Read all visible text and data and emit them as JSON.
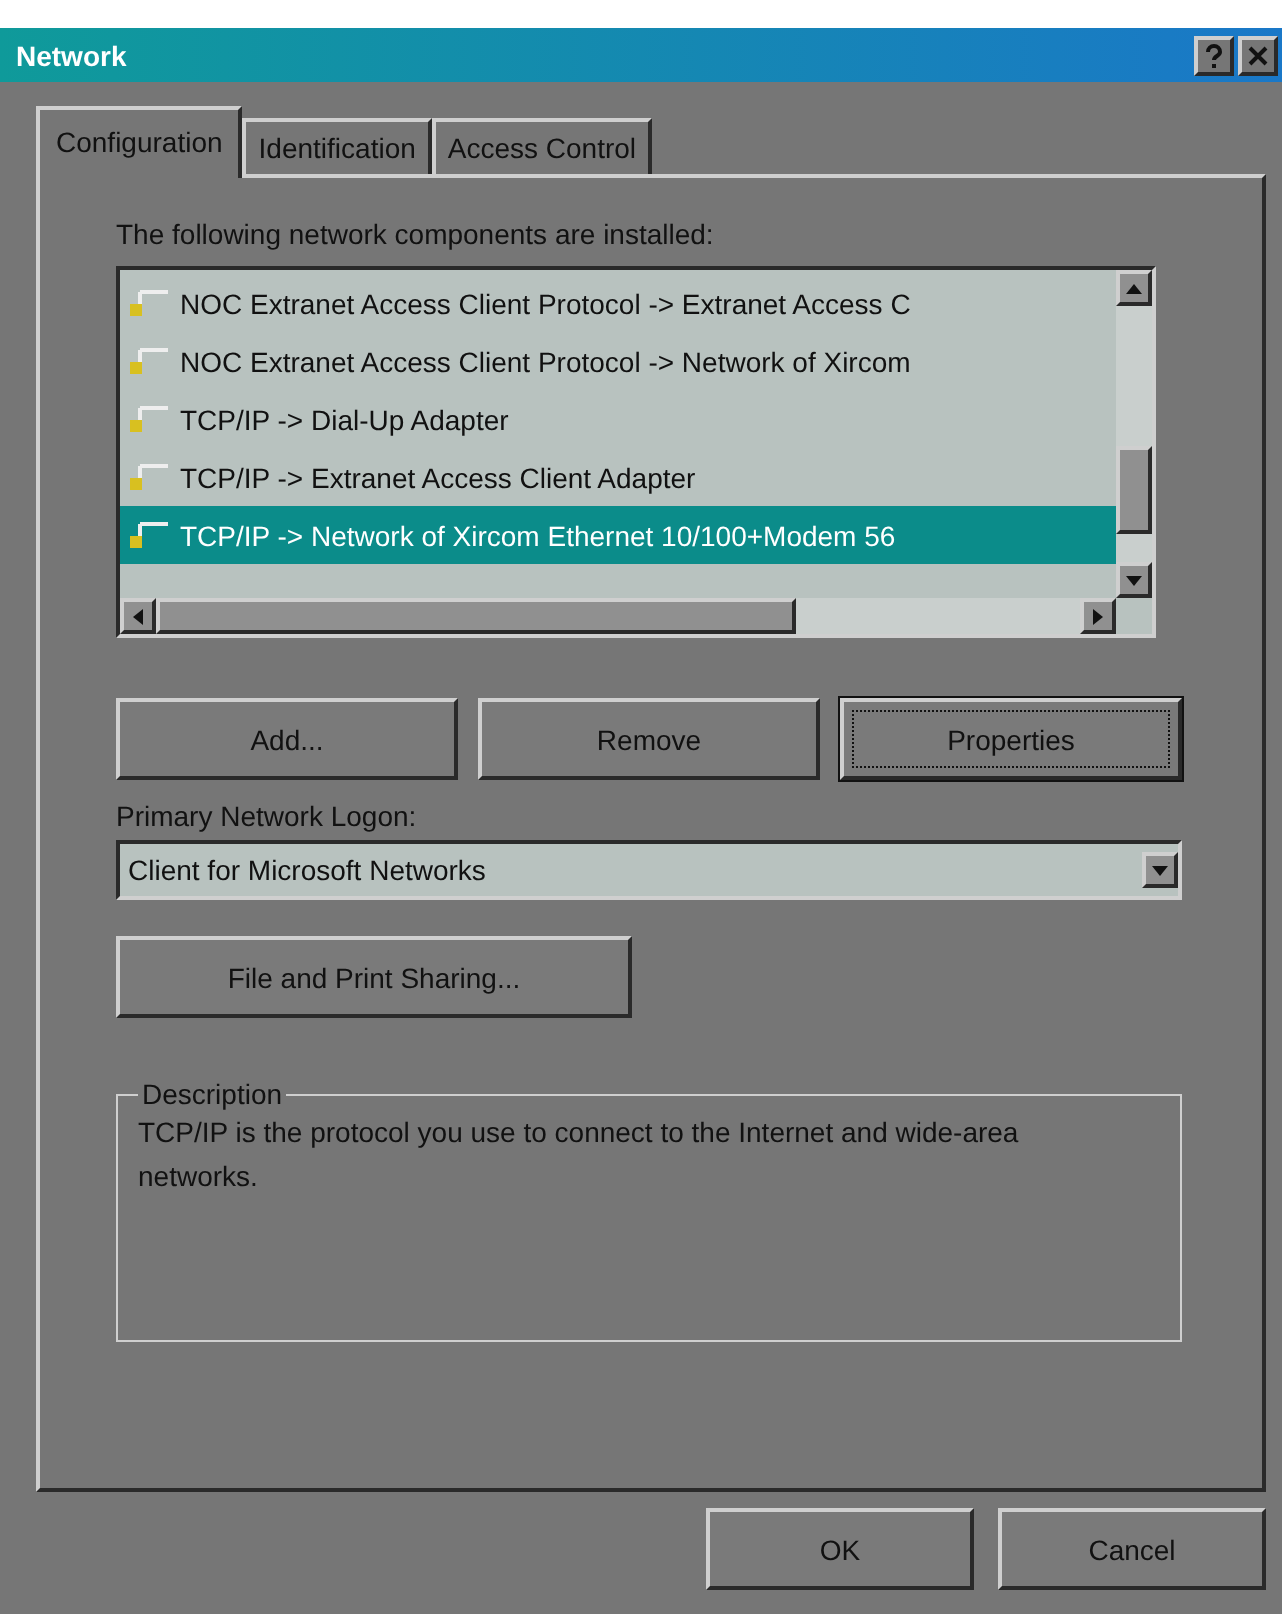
{
  "window": {
    "title": "Network"
  },
  "tabs": [
    {
      "label": "Configuration",
      "selected": true
    },
    {
      "label": "Identification",
      "selected": false
    },
    {
      "label": "Access Control",
      "selected": false
    }
  ],
  "components": {
    "label": "The following network components are installed:",
    "items": [
      {
        "label": "NOC Extranet Access Client Protocol -> Extranet Access C",
        "selected": false
      },
      {
        "label": "NOC Extranet Access Client Protocol -> Network of Xircom",
        "selected": false
      },
      {
        "label": "TCP/IP -> Dial-Up Adapter",
        "selected": false
      },
      {
        "label": "TCP/IP -> Extranet Access Client Adapter",
        "selected": false
      },
      {
        "label": "TCP/IP -> Network of Xircom Ethernet 10/100+Modem 56",
        "selected": true
      }
    ]
  },
  "component_buttons": [
    {
      "label": "Add...",
      "focused": false
    },
    {
      "label": "Remove",
      "focused": false
    },
    {
      "label": "Properties",
      "focused": true
    }
  ],
  "logon": {
    "label": "Primary Network Logon:",
    "value": "Client for Microsoft Networks"
  },
  "sharing_button": "File and Print Sharing...",
  "description": {
    "title": "Description",
    "text": "TCP/IP is the protocol you use to connect to the Internet and wide-area networks."
  },
  "buttons": [
    "OK",
    "Cancel"
  ]
}
